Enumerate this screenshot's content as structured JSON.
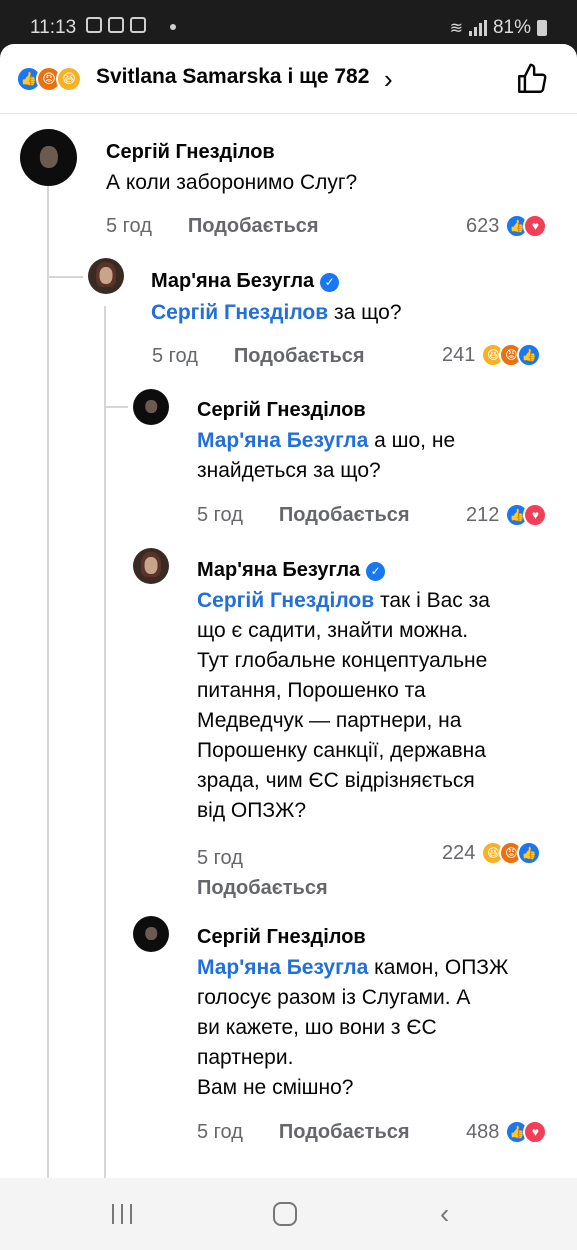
{
  "status_bar": {
    "time": "11:13",
    "battery": "81%"
  },
  "header": {
    "reactors": "Svitlana Samarska і ще 782",
    "reactions": [
      "like-icon",
      "angry-icon",
      "haha-icon"
    ]
  },
  "comments": [
    {
      "author": "Сергій Гнезділов",
      "text": "А коли заборонимо Слуг?",
      "time": "5 год",
      "like_label": "Подобається",
      "count": "623",
      "verified": false
    },
    {
      "author": "Мар'яна Безугла",
      "mention": "Сергій Гнезділов",
      "text": " за що?",
      "time": "5 год",
      "like_label": "Подобається",
      "count": "241",
      "verified": true
    },
    {
      "author": "Сергій Гнезділов",
      "mention": "Мар'яна Безугла",
      "text": " а шо, не\nзнайдеться за що?",
      "time": "5 год",
      "like_label": "Подобається",
      "count": "212",
      "verified": false
    },
    {
      "author": "Мар'яна Безугла",
      "mention": "Сергій Гнезділов",
      "text": " так і Вас за\nщо є садити, знайти можна.\nТут глобальне концептуальне\nпитання, Порошенко та\nМедведчук — партнери, на\nПорошенку санкції, державна\nзрада, чим ЄС відрізняється\nвід ОПЗЖ?",
      "time": "5 год",
      "like_label": "Подобається",
      "count": "224",
      "verified": true
    },
    {
      "author": "Сергій Гнезділов",
      "mention": "Мар'яна Безугла",
      "text": " камон, ОПЗЖ\nголосує разом із Слугами. А\nви кажете, шо вони з ЄС\nпартнери.\nВам не смішно?",
      "time": "5 год",
      "like_label": "Подобається",
      "count": "488",
      "verified": false
    }
  ]
}
